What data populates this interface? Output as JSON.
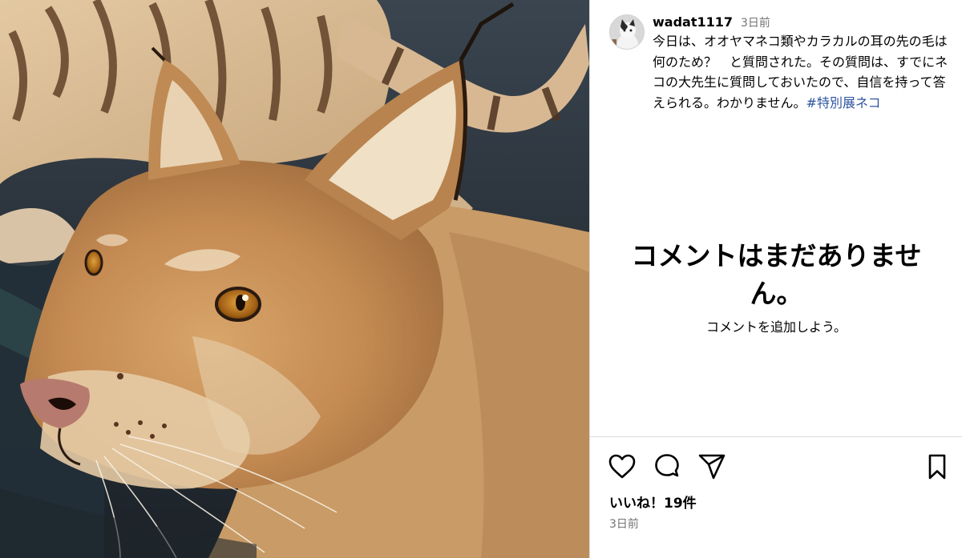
{
  "post": {
    "image_alt": "",
    "username": "wadat1117",
    "time_ago": "3日前",
    "caption": "今日は、オオヤマネコ類やカラカルの耳の先の毛は何のため？　と質問された。その質問は、すでにネコの大先生に質問しておいたので、自信を持って答えられる。わかりません。",
    "hashtag": "#特別展ネコ",
    "likes_label": "いいね！19件",
    "date_label": "3日前"
  },
  "comments": {
    "empty_title": "コメントはまだありません。",
    "empty_subtitle": "コメントを追加しよう。"
  },
  "icons": {
    "like": "heart-icon",
    "comment": "comment-bubble-icon",
    "share": "paper-plane-icon",
    "save": "bookmark-icon"
  },
  "colors": {
    "hashtag": "#2d54a0",
    "muted": "#737373",
    "divider": "#dbdbdb"
  }
}
